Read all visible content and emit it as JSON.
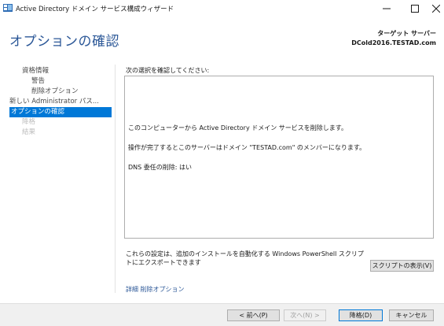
{
  "window": {
    "title": "Active Directory ドメイン サービス構成ウィザード",
    "minimize_glyph": "−",
    "maximize_glyph": "☐",
    "close_glyph": "✕"
  },
  "header": {
    "page_title": "オプションの確認",
    "target_label": "ターゲット サーバー",
    "target_server": "DCold2016.TESTAD.com"
  },
  "nav": {
    "items": [
      {
        "label": "資格情報"
      },
      {
        "label": "警告"
      },
      {
        "label": "削除オプション"
      },
      {
        "label": "新しい Administrator パス..."
      },
      {
        "label": "オプションの確認"
      },
      {
        "label": "降格"
      },
      {
        "label": "結果"
      }
    ]
  },
  "content": {
    "prompt": "次の選択を確認してください:",
    "review_lines": [
      "このコンピューターから Active Directory ドメイン サービスを削除します。",
      "操作が完了するとこのサーバーはドメイン \"TESTAD.com\" のメンバーになります。",
      "DNS 委任の削除: はい"
    ],
    "powershell_note": "これらの設定は、追加のインストールを自動化する Windows PowerShell スクリプトにエクスポートできます",
    "view_script_button": "スクリプトの表示(V)",
    "more_link": "詳細 削除オプション"
  },
  "footer": {
    "prev_button": "< 前へ(P)",
    "next_button": "次へ(N) >",
    "demote_button": "降格(D)",
    "cancel_button": "キャンセル"
  },
  "colors": {
    "accent": "#0078d7",
    "title_blue": "#2b5797"
  }
}
